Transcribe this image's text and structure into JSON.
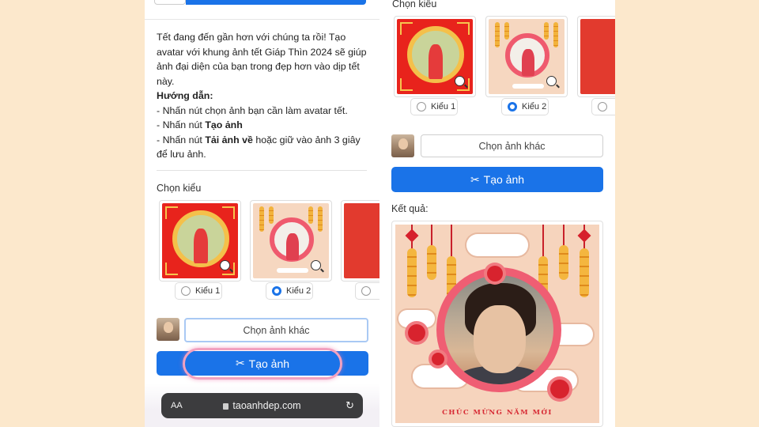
{
  "left_phone": {
    "intro": {
      "line1": "Tết đang đến gần hơn với chúng ta rồi! Tạo avatar với khung ảnh tết Giáp Thìn 2024 sẽ giúp ảnh đại diện của bạn trong đẹp hơn vào dịp tết này.",
      "guide_title": "Hướng dẫn:",
      "step1": "- Nhấn nút chọn ảnh bạn cần làm avatar tết.",
      "step2_prefix": "- Nhấn nút ",
      "step2_bold": "Tạo ảnh",
      "step3_prefix": "- Nhấn nút ",
      "step3_bold": "Tải ảnh về",
      "step3_suffix": " hoặc giữ vào ảnh 3 giây để lưu ảnh."
    },
    "choose_style_label": "Chọn kiểu",
    "styles": [
      {
        "label": "Kiểu 1",
        "selected": false
      },
      {
        "label": "Kiểu 2",
        "selected": true
      }
    ],
    "choose_other_photo": "Chọn ảnh khác",
    "create_button": "Tạo ảnh",
    "url_bar": {
      "text_size": "AA",
      "host": "taoanhdep.com"
    }
  },
  "right_phone": {
    "choose_style_label": "Chọn kiểu",
    "styles": [
      {
        "label": "Kiểu 1",
        "selected": false
      },
      {
        "label": "Kiểu 2",
        "selected": true
      }
    ],
    "choose_other_photo": "Chọn ảnh khác",
    "create_button": "Tạo ảnh",
    "result_label": "Kết quả:",
    "frame_text": "CHÚC MỪNG NĂM MỚI"
  },
  "colors": {
    "background": "#fce8cc",
    "primary": "#1a73e8",
    "frame_red": "#e8231c",
    "frame_peach": "#f6d7c0"
  }
}
